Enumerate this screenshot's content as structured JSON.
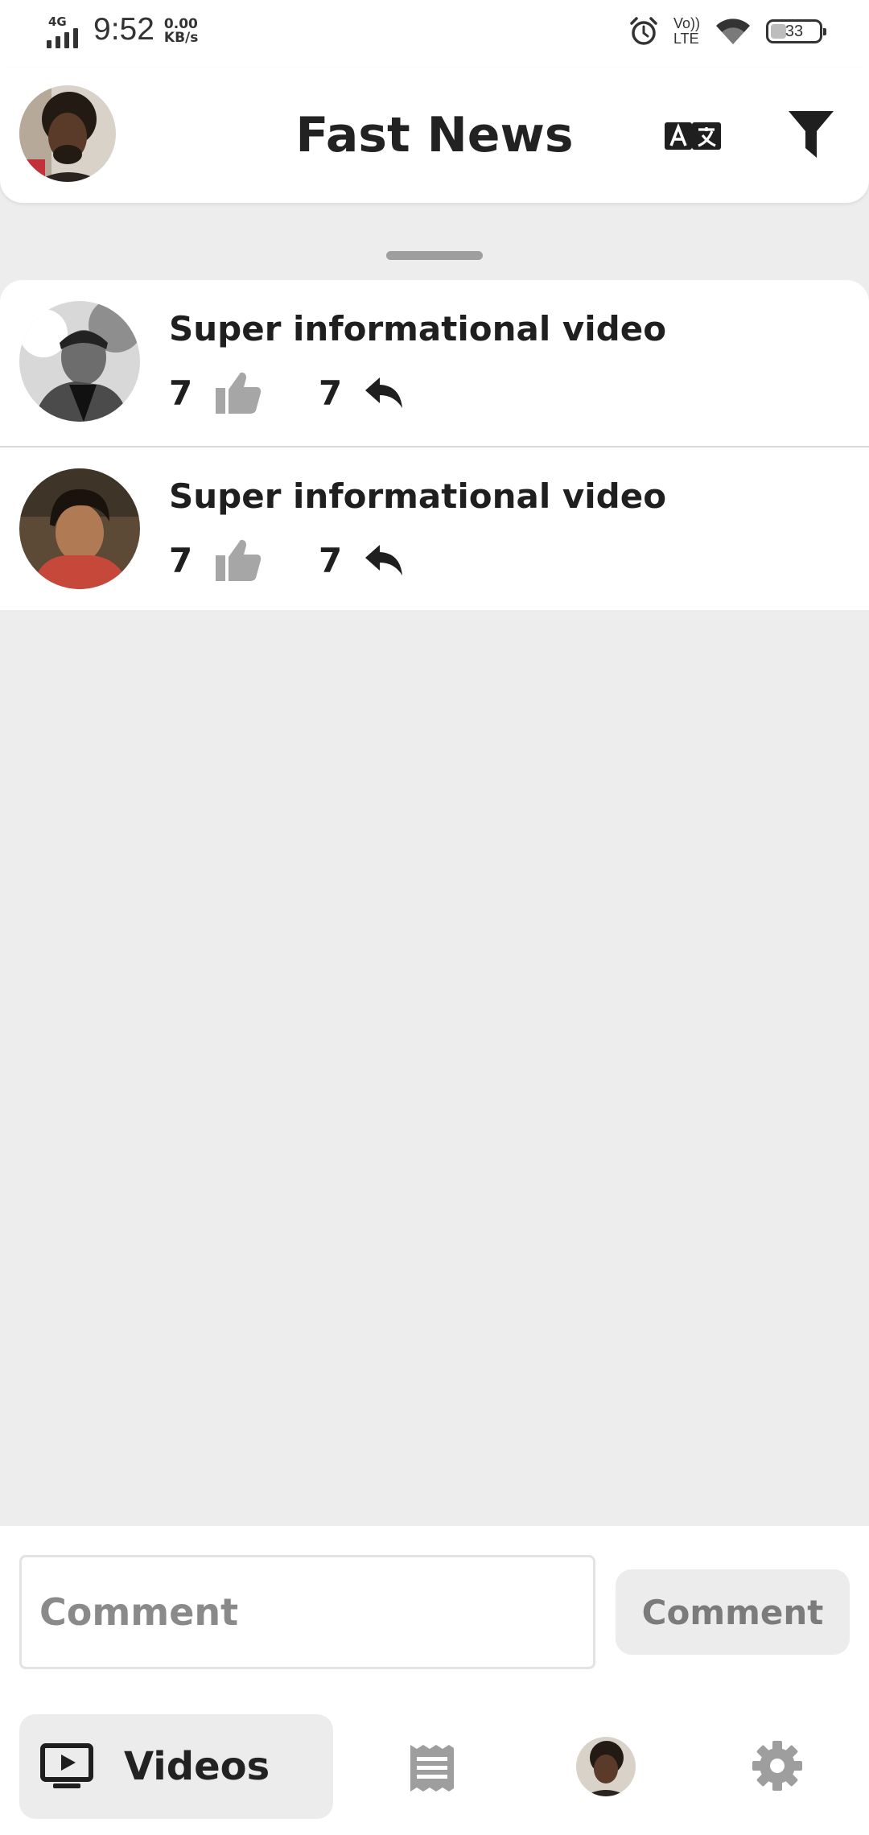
{
  "status_bar": {
    "network": "4G",
    "time": "9:52",
    "speed_value": "0.00",
    "speed_unit": "KB/s",
    "volte_top": "Vo))",
    "volte_bottom": "LTE",
    "battery": "33",
    "icons": [
      "signal-icon",
      "alarm-icon",
      "volte-icon",
      "wifi-icon",
      "battery-icon"
    ]
  },
  "header": {
    "title": "Fast News",
    "icons": [
      "avatar",
      "translate-icon",
      "filter-icon"
    ]
  },
  "comments": [
    {
      "text": "Super informational video",
      "likes": "7",
      "replies": "7"
    },
    {
      "text": "Super informational video",
      "likes": "7",
      "replies": "7"
    }
  ],
  "composer": {
    "placeholder": "Comment",
    "button_label": "Comment"
  },
  "bottom_nav": {
    "active_label": "Videos",
    "items": [
      "videos-icon",
      "news-icon",
      "profile-avatar",
      "settings-icon"
    ]
  },
  "colors": {
    "background": "#ededed",
    "surface": "#ffffff",
    "text": "#1f1f1f",
    "muted": "#8a8a8a",
    "like_icon": "#a6a6a6",
    "inactive_icon": "#9e9e9e"
  }
}
